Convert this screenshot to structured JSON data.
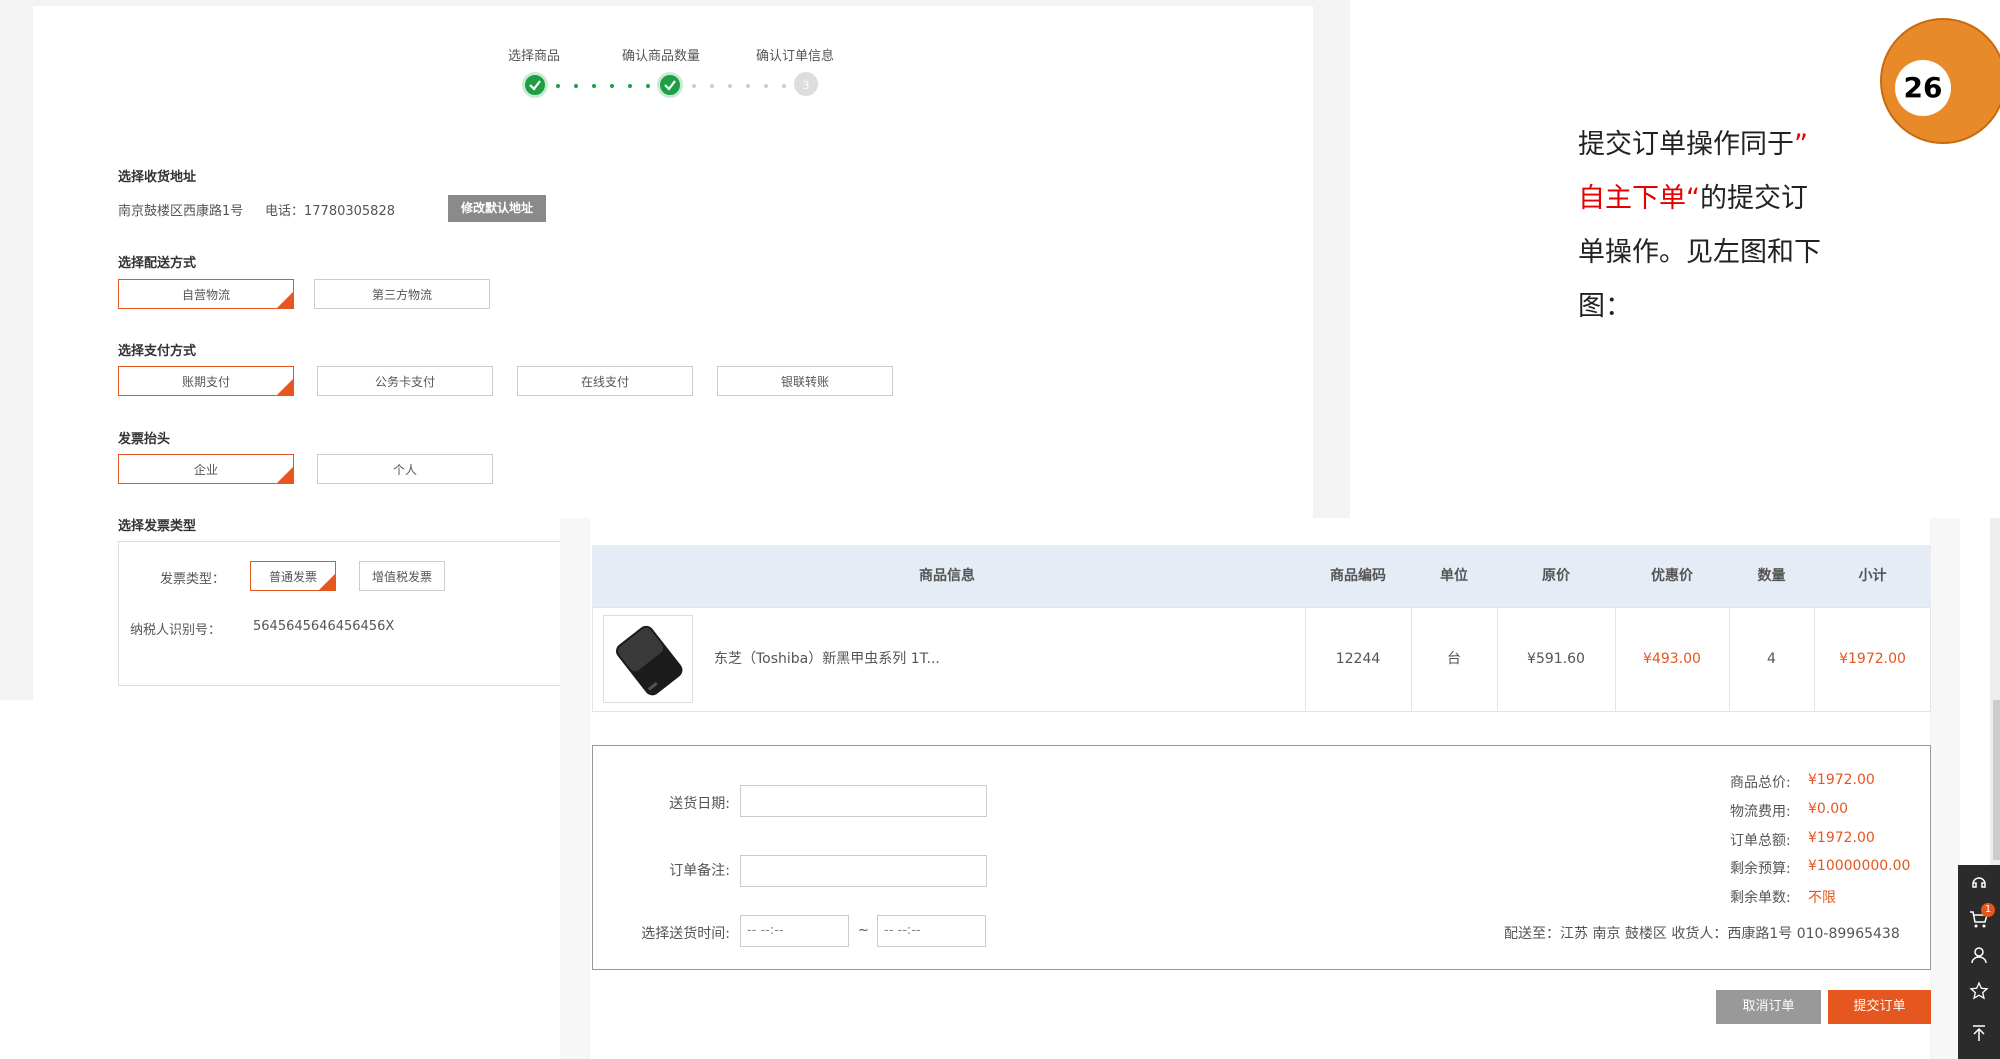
{
  "steps": [
    {
      "label": "选择商品",
      "state": "done"
    },
    {
      "label": "确认商品数量",
      "state": "done"
    },
    {
      "label": "确认订单信息",
      "number": "3",
      "state": "todo"
    }
  ],
  "address": {
    "title": "选择收货地址",
    "text": "南京鼓楼区西康路1号",
    "phone": "电话：17780305828",
    "modify_btn": "修改默认地址"
  },
  "delivery": {
    "title": "选择配送方式",
    "options": [
      "自营物流",
      "第三方物流"
    ],
    "selected": "自营物流"
  },
  "payment": {
    "title": "选择支付方式",
    "options": [
      "账期支付",
      "公务卡支付",
      "在线支付",
      "银联转账"
    ],
    "selected": "账期支付"
  },
  "invoice_header": {
    "title": "发票抬头",
    "options": [
      "企业",
      "个人"
    ],
    "selected": "企业"
  },
  "invoice_type": {
    "title": "选择发票类型",
    "type_label": "发票类型：",
    "options": [
      "普通发票",
      "增值税发票"
    ],
    "selected": "普通发票",
    "taxpayer_label": "纳税人识别号：",
    "taxpayer_value": "5645645646456456X"
  },
  "note": {
    "line1": "提交订单操作同于",
    "quote_open": "”",
    "red_text": "自主下单",
    "quote_close": "“",
    "line2_rest": "的提交订",
    "line3": "单操作。见左图和下",
    "line4": "图："
  },
  "badge": "26",
  "table": {
    "headers": [
      "商品信息",
      "商品编码",
      "单位",
      "原价",
      "优惠价",
      "数量",
      "小计"
    ],
    "row": {
      "name": "东芝（Toshiba）新黑甲虫系列 1T...",
      "code": "12244",
      "unit": "台",
      "original_price": "¥591.60",
      "discount_price": "¥493.00",
      "quantity": "4",
      "subtotal": "¥1972.00"
    }
  },
  "form": {
    "delivery_date_label": "送货日期:",
    "remark_label": "订单备注:",
    "time_label": "选择送货时间:",
    "time_from_placeholder": "-- --:--",
    "time_sep": "~",
    "time_to_placeholder": "-- --:--"
  },
  "summary": {
    "goods_total_label": "商品总价:",
    "goods_total": "¥1972.00",
    "shipping_label": "物流费用:",
    "shipping": "¥0.00",
    "order_total_label": "订单总额:",
    "order_total": "¥1972.00",
    "budget_label": "剩余预算:",
    "budget": "¥10000000.00",
    "orders_left_label": "剩余单数:",
    "orders_left": "不限",
    "ship_to": "配送至：江苏 南京 鼓楼区 收货人：西康路1号 010-89965438"
  },
  "buttons": {
    "cancel": "取消订单",
    "submit": "提交订单"
  },
  "side_toolbar": {
    "cart_count": "1",
    "icons": [
      "service-icon",
      "cart-icon",
      "user-icon",
      "star-icon",
      "to-top-icon"
    ]
  },
  "colors": {
    "accent": "#e6561f",
    "success": "#1e9e45",
    "annotation_red": "#e60000",
    "badge": "#e8892a"
  }
}
